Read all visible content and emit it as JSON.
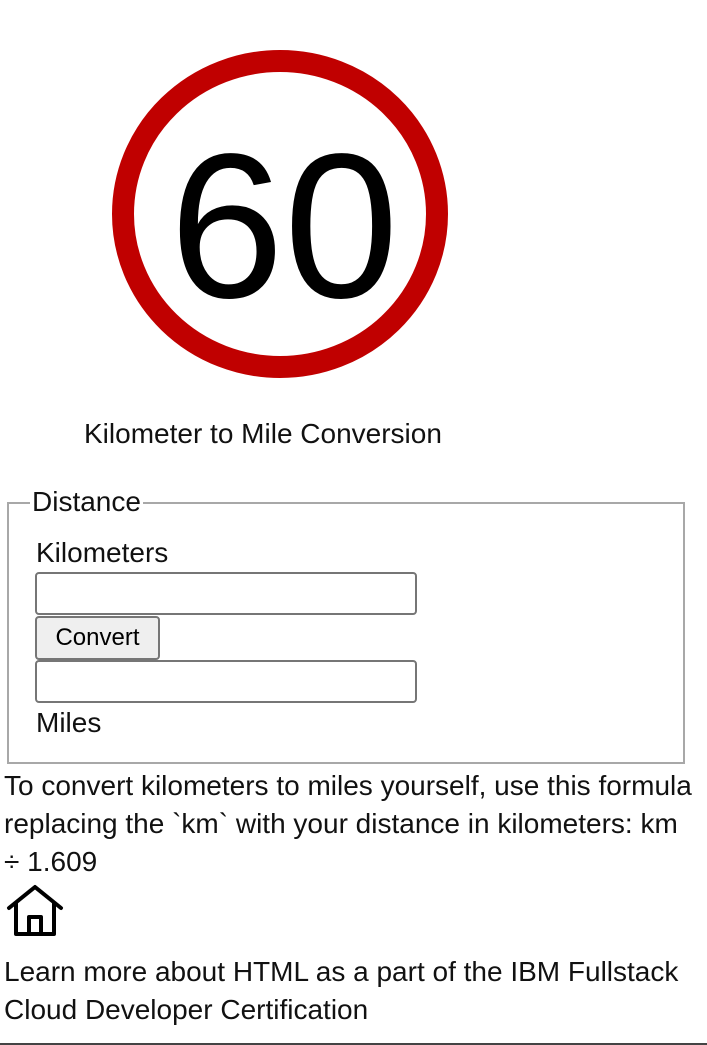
{
  "sign": {
    "speed": "60",
    "ring_color": "#c00000"
  },
  "heading": "Kilometer to Mile Conversion",
  "form": {
    "legend": "Distance",
    "km_label": "Kilometers",
    "km_value": "",
    "convert_label": "Convert",
    "mi_value": "",
    "mi_label": "Miles"
  },
  "formula_text": "To convert kilometers to miles yourself, use this formula replacing the `km` with your distance in kilometers: km ÷ 1.609",
  "home_icon": "home-icon",
  "learn_text": "Learn more about HTML as a part of the IBM Fullstack Cloud Developer Certification"
}
